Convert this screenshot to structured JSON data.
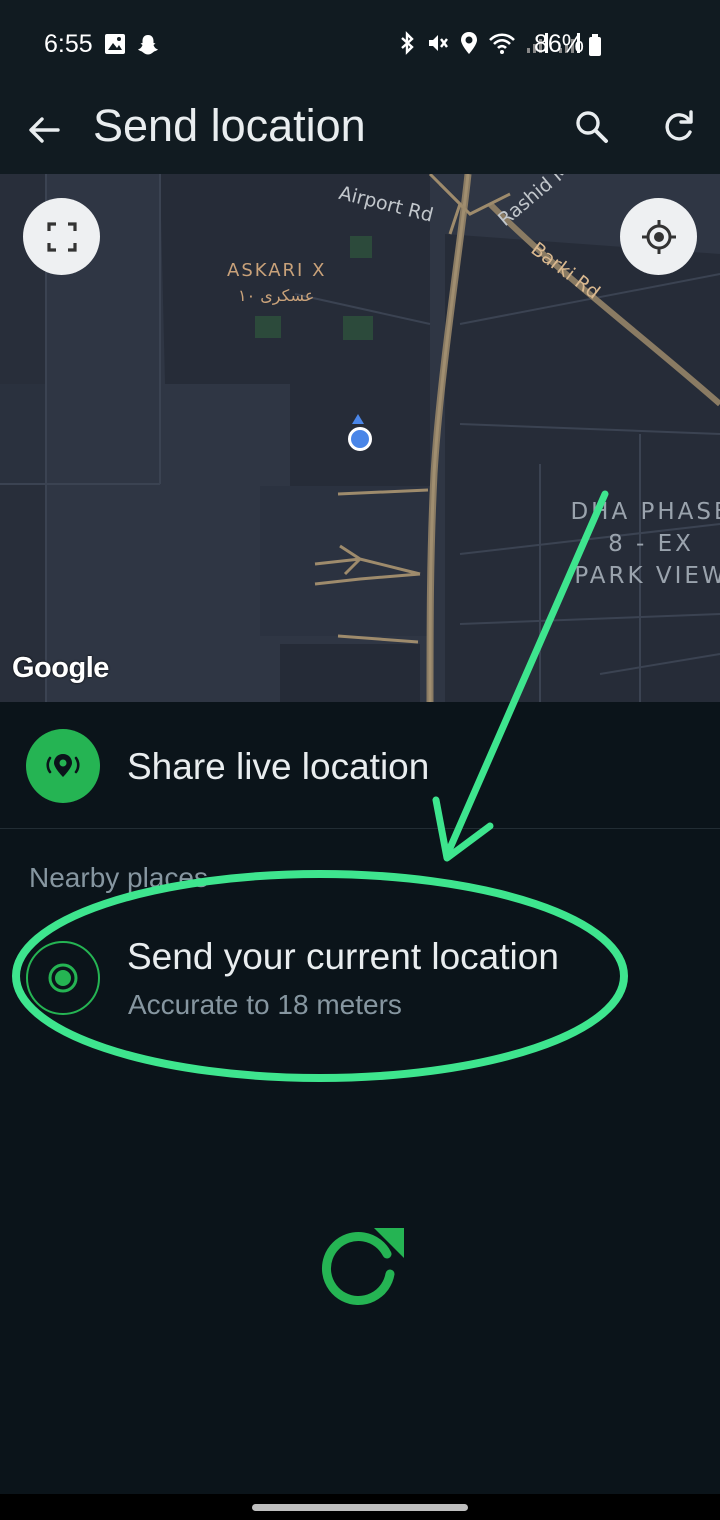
{
  "status_bar": {
    "time": "6:55",
    "battery_percent": "86%",
    "icons": [
      "gallery-icon",
      "snapchat-icon",
      "bluetooth-icon",
      "mute-icon",
      "location-icon",
      "wifi-icon",
      "signal-icon",
      "signal-icon",
      "battery-icon"
    ]
  },
  "app_bar": {
    "title": "Send location",
    "back_icon": "arrow-left-icon",
    "search_icon": "search-icon",
    "refresh_icon": "refresh-icon"
  },
  "map": {
    "labels": {
      "askari": "ASKARI X",
      "askari_ar": "عسکری ١٠",
      "dha_line1": "DHA PHASE",
      "dha_line2": "8 - EX",
      "dha_line3": "PARK VIEW",
      "airport_rd": "Airport Rd",
      "rashid": "Rashid M",
      "barki_rd": "Barki Rd"
    },
    "attribution": "Google",
    "fullscreen_icon": "fullscreen-icon",
    "locate_icon": "my-location-icon"
  },
  "live_location": {
    "label": "Share live location",
    "icon": "live-location-icon"
  },
  "nearby": {
    "header": "Nearby places",
    "current": {
      "title": "Send your current location",
      "subtitle": "Accurate to 18 meters",
      "icon": "current-location-icon"
    }
  },
  "colors": {
    "accent": "#25b453",
    "annotation": "#3ee58e",
    "background": "#0b141a",
    "bar": "#111b21"
  }
}
